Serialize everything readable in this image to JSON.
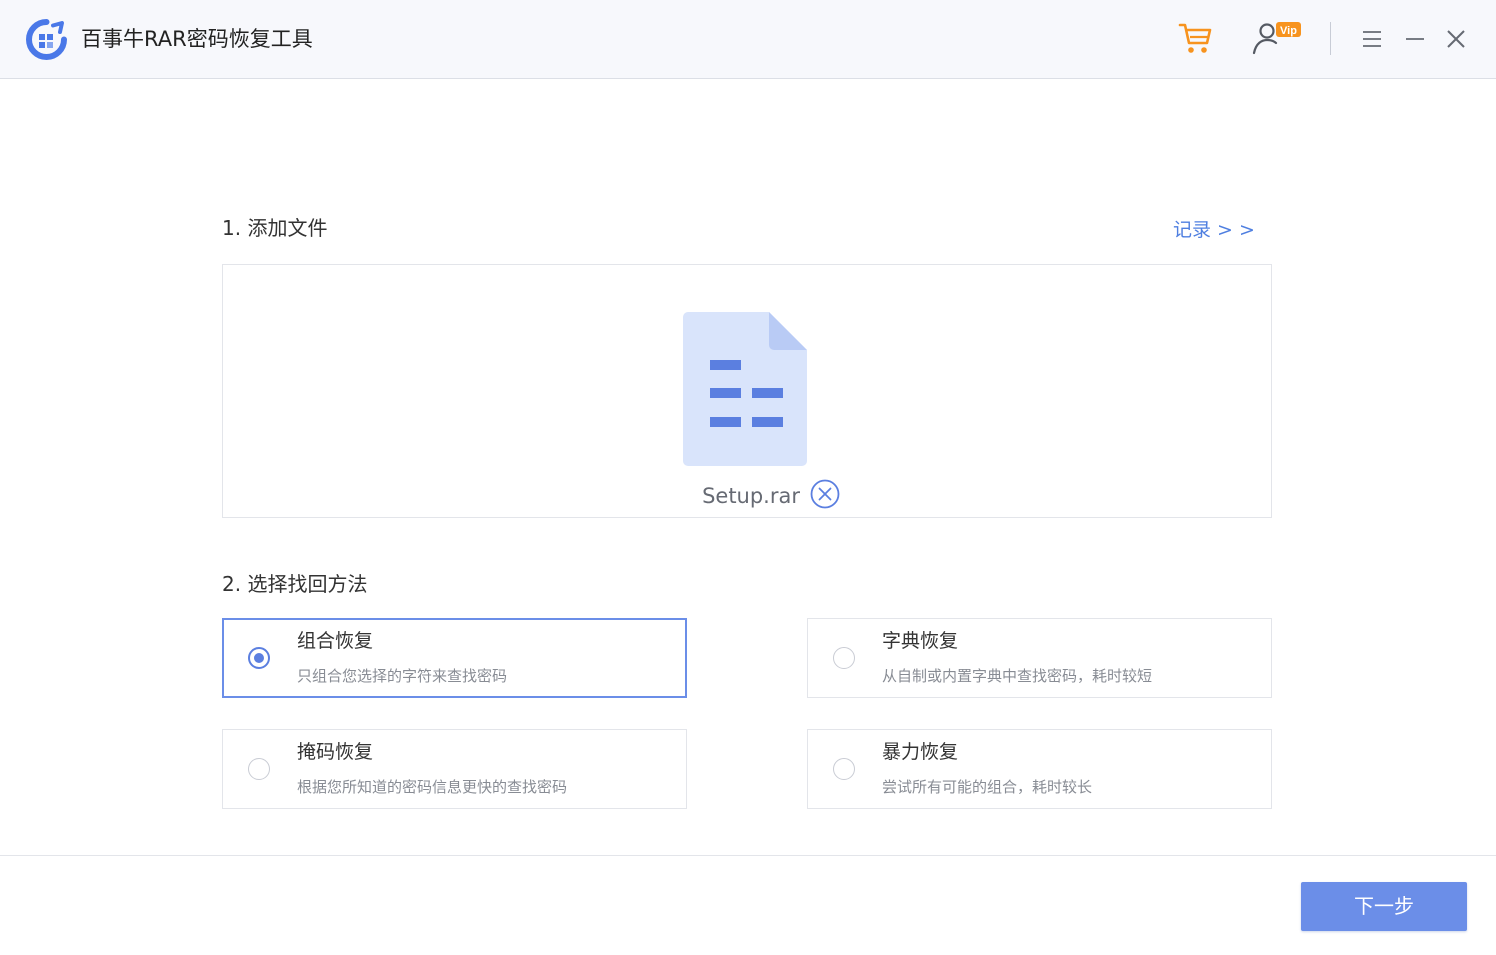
{
  "window": {
    "title": "百事牛RAR密码恢复工具"
  },
  "header": {
    "icons": [
      "cart-icon",
      "vip-user-icon",
      "menu-icon",
      "minimize-icon",
      "close-icon"
    ],
    "vip_badge": "Vip"
  },
  "step1": {
    "title": "1. 添加文件",
    "history_link": "记录 > >",
    "file_name": "Setup.rar"
  },
  "step2": {
    "title": "2. 选择找回方法",
    "methods": [
      {
        "title": "组合恢复",
        "description": "只组合您选择的字符来查找密码",
        "selected": true
      },
      {
        "title": "字典恢复",
        "description": "从自制或内置字典中查找密码，耗时较短",
        "selected": false
      },
      {
        "title": "掩码恢复",
        "description": "根据您所知道的密码信息更快的查找密码",
        "selected": false
      },
      {
        "title": "暴力恢复",
        "description": "尝试所有可能的组合，耗时较长",
        "selected": false
      }
    ]
  },
  "footer": {
    "next_label": "下一步"
  },
  "colors": {
    "accent": "#6b8ee8",
    "link": "#4f7fe0",
    "cart_orange": "#f7931e",
    "file_icon_fill": "#d9e4fb",
    "file_icon_lines": "#5b7fe0",
    "logo_blue": "#4a78e8"
  }
}
